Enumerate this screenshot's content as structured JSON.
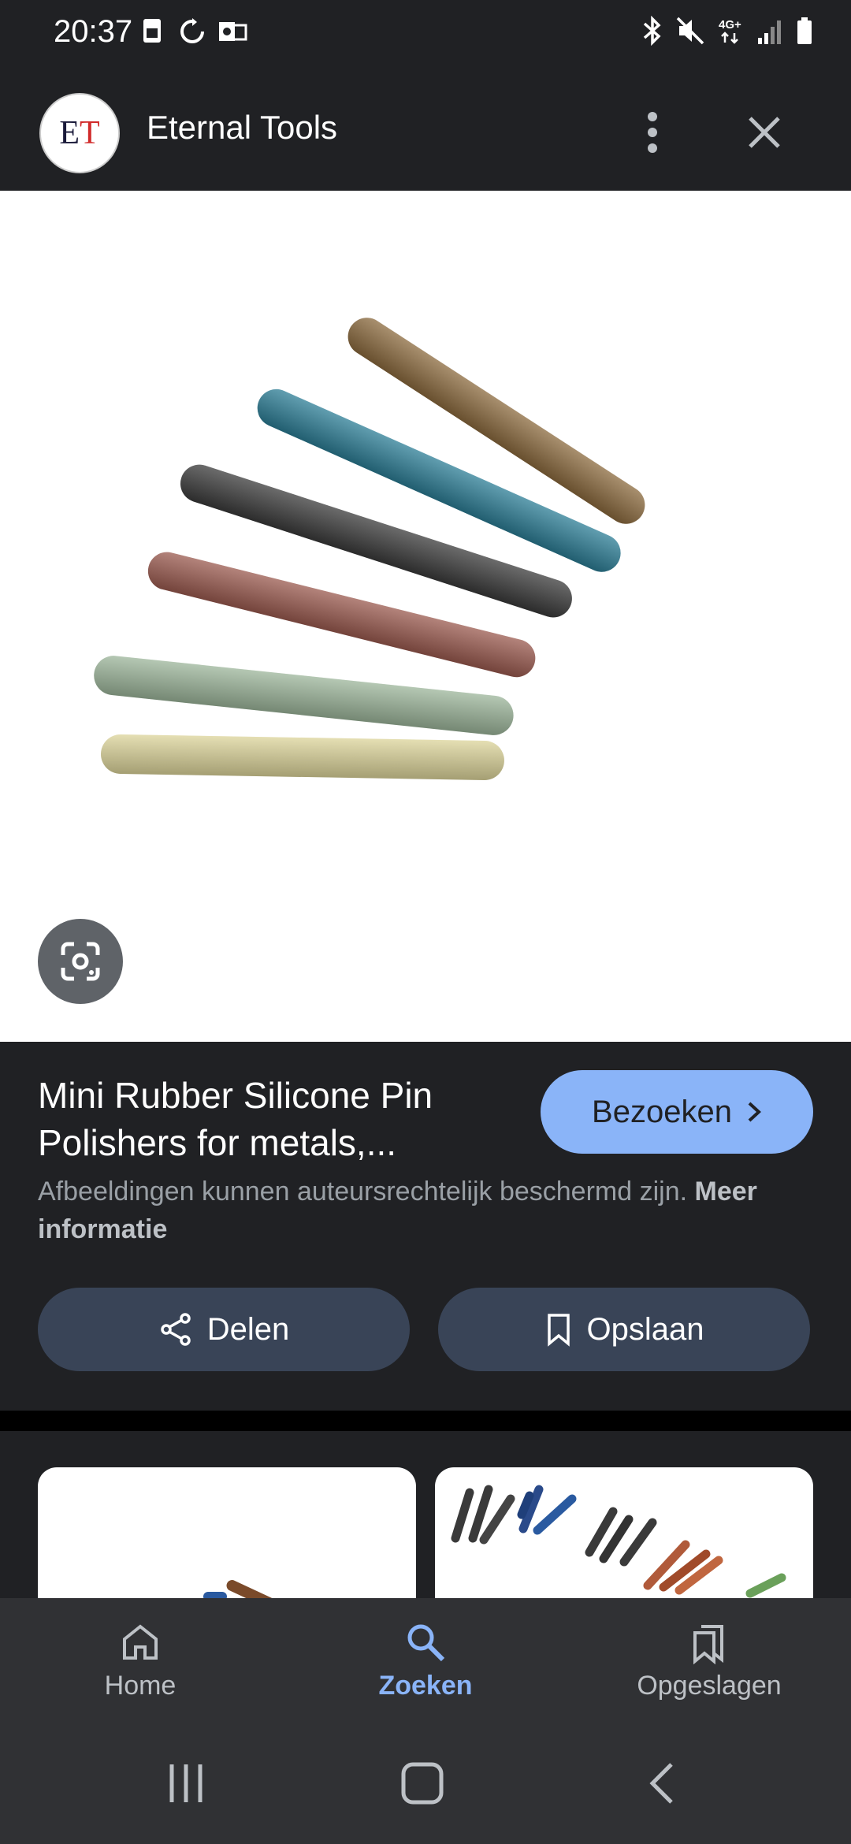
{
  "status_bar": {
    "time": "20:37",
    "left_icons": [
      "sim-card-icon",
      "sync-icon",
      "outlook-icon"
    ],
    "right_icons": [
      "bluetooth-icon",
      "mute-icon",
      "4g-icon",
      "signal-icon",
      "battery-icon"
    ],
    "network": "4G+"
  },
  "app_bar": {
    "site_logo_text": "ET",
    "site_name": "Eternal Tools",
    "menu_icon": "more-vert-icon",
    "close_icon": "close-icon"
  },
  "image": {
    "description_icon": "google-lens-icon"
  },
  "result": {
    "title": "Mini Rubber Silicone Pin Polishers for metals,...",
    "visit_label": "Bezoeken",
    "disclaimer_text": "Afbeeldingen kunnen auteursrechtelijk beschermd zijn.",
    "disclaimer_link": "Meer informatie",
    "share_label": "Delen",
    "save_label": "Opslaan"
  },
  "bottom_nav": {
    "items": [
      {
        "label": "Home",
        "icon": "home-icon",
        "active": false
      },
      {
        "label": "Zoeken",
        "icon": "search-icon",
        "active": true
      },
      {
        "label": "Opgeslagen",
        "icon": "bookmarks-icon",
        "active": false
      }
    ]
  },
  "colors": {
    "background": "#202124",
    "accent": "#8ab4f8",
    "button_bg": "#394457"
  }
}
